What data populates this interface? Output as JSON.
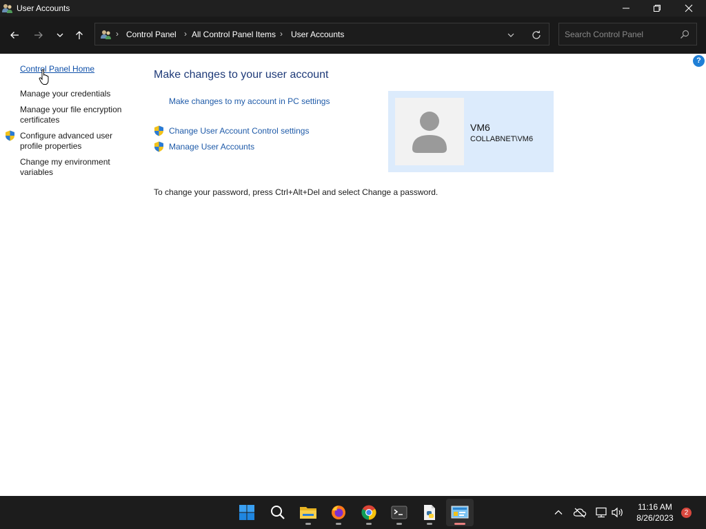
{
  "window": {
    "title": "User Accounts"
  },
  "address_bar": {
    "breadcrumbs": [
      "Control Panel",
      "All Control Panel Items",
      "User Accounts"
    ],
    "search_placeholder": "Search Control Panel"
  },
  "sidebar": {
    "items": [
      {
        "label": "Control Panel Home"
      },
      {
        "label": "Manage your credentials"
      },
      {
        "label": "Manage your file encryption certificates"
      },
      {
        "label": "Configure advanced user profile properties"
      },
      {
        "label": "Change my environment variables"
      }
    ]
  },
  "main": {
    "title": "Make changes to your user account",
    "links": [
      {
        "label": "Make changes to my account in PC settings"
      },
      {
        "label": "Change User Account Control settings"
      },
      {
        "label": "Manage User Accounts"
      }
    ],
    "password_note": "To change your password, press Ctrl+Alt+Del and select Change a password."
  },
  "user": {
    "name": "VM6",
    "domain": "COLLABNET\\VM6"
  },
  "taskbar": {
    "apps": [
      "start-icon",
      "search-icon",
      "file-explorer-icon",
      "firefox-icon",
      "chrome-icon",
      "terminal-icon",
      "python-file-icon",
      "control-panel-icon"
    ],
    "clock_time": "11:16 AM",
    "clock_date": "8/26/2023",
    "notification_count": "2"
  },
  "colors": {
    "link": "#1e5aa8",
    "title": "#1e3a78",
    "titlebar_bg": "#202020",
    "taskbar_bg": "#1c1c1c",
    "user_card_bg": "#dcebfc"
  }
}
